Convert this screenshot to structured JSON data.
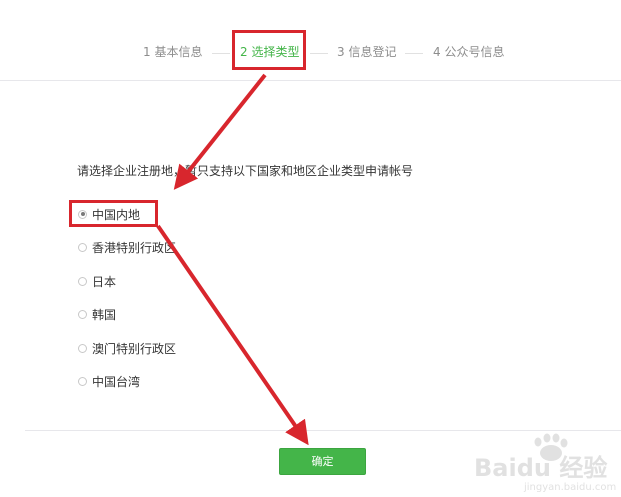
{
  "steps": [
    {
      "label": "1 基本信息",
      "active": false
    },
    {
      "label": "2 选择类型",
      "active": true
    },
    {
      "label": "3 信息登记",
      "active": false
    },
    {
      "label": "4 公众号信息",
      "active": false
    }
  ],
  "prompt": "请选择企业注册地，暂只支持以下国家和地区企业类型申请帐号",
  "regions": [
    {
      "label": "中国内地",
      "checked": true
    },
    {
      "label": "香港特别行政区",
      "checked": false
    },
    {
      "label": "日本",
      "checked": false
    },
    {
      "label": "韩国",
      "checked": false
    },
    {
      "label": "澳门特别行政区",
      "checked": false
    },
    {
      "label": "中国台湾",
      "checked": false
    }
  ],
  "confirm_label": "确定",
  "watermark": {
    "brand": "Baidu 经验",
    "url": "jingyan.baidu.com"
  },
  "colors": {
    "accent_green": "#44b549",
    "annotation_red": "#d8262d",
    "text": "#353535",
    "muted": "#8d8d8d"
  }
}
